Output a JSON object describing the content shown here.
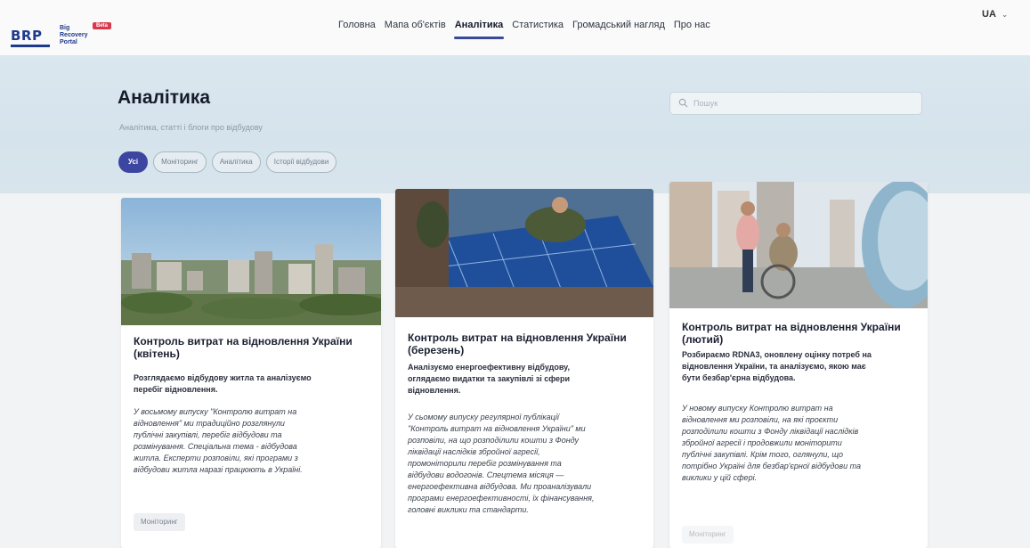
{
  "header": {
    "logo": {
      "mark": "BRP",
      "line1": "Big",
      "line2": "Recovery",
      "line3": "Portal",
      "badge": "Beta"
    },
    "nav": [
      "Головна",
      "Мапа об'єктів",
      "Аналітика",
      "Статистика",
      "Громадський нагляд",
      "Про нас"
    ],
    "active_nav": "Аналітика",
    "language": "UA"
  },
  "hero": {
    "title": "Аналітика",
    "subtitle": "Аналітика, статті і блоги про відбудову",
    "search_placeholder": "Пошук",
    "filters": [
      "Усі",
      "Моніторинг",
      "Аналітика",
      "Історії відбудови"
    ],
    "active_filter": "Усі"
  },
  "cards": [
    {
      "title_line1": "Контроль витрат на відновлення України",
      "title_line2": "(квітень)",
      "lead_line1": "Розглядаємо відбудову житла та аналізуємо",
      "lead_line2": "перебіг відновлення.",
      "body_lines": [
        "У восьмому випуску \"Контролю витрат на",
        "відновлення\" ми традиційно розглянули",
        "публічні закупівлі, перебіг відбудови та",
        "розмінування. Спеціальна тема - відбудова",
        "житла. Експерти розповіли, які програми з",
        "відбудови житла наразі працюють в Україні."
      ],
      "tag": "Моніторинг"
    },
    {
      "title_line1": "Контроль витрат на відновлення України",
      "title_line2": "(березень)",
      "lead_line1": "Аналізуємо енергоефективну відбудову,",
      "lead_line2": "оглядаємо видатки та закупівлі зі сфери",
      "lead_line3": "відновлення.",
      "body_lines": [
        "У сьомому випуску регулярної публікації",
        "\"Контроль витрат на відновлення України\" ми",
        "розповіли, на що розподілили кошти з Фонду",
        "ліквідації наслідків збройної агресії,",
        "промоніторили перебіг розмінування та",
        "відбудови водогонів. Спецтема місяця —",
        "енергоефективна відбудова. Ми проаналізували",
        "програми енергоефективності, їх фінансування,",
        "головні виклики та стандарти."
      ]
    },
    {
      "title_line1": "Контроль витрат на відновлення України",
      "title_line2": "(лютий)",
      "lead_line1": "Розбираємо RDNA3, оновлену оцінку потреб на",
      "lead_line2": "відновлення України, та аналізуємо, якою має",
      "lead_line3": "бути безбар'єрна відбудова.",
      "body_lines": [
        "У новому випуску Контролю витрат на",
        "відновлення ми розповіли, на які проєкти",
        "розподілили кошти з Фонду ліквідації наслідків",
        "збройної агресії і продовжили моніторити",
        "публічні закупівлі. Крім того, оглянули, що",
        "потрібно Україні для безбар'єрної відбудови та",
        "виклики у цій сфері."
      ],
      "tag": "Моніторинг"
    }
  ],
  "colors": {
    "accent": "#3c46a0",
    "brand": "#1f3a8c",
    "badge": "#d8384b",
    "hero_bg": "#d8e5ed"
  },
  "icons": {
    "search": "search-icon",
    "language_dropdown": "chevron-down-icon"
  }
}
